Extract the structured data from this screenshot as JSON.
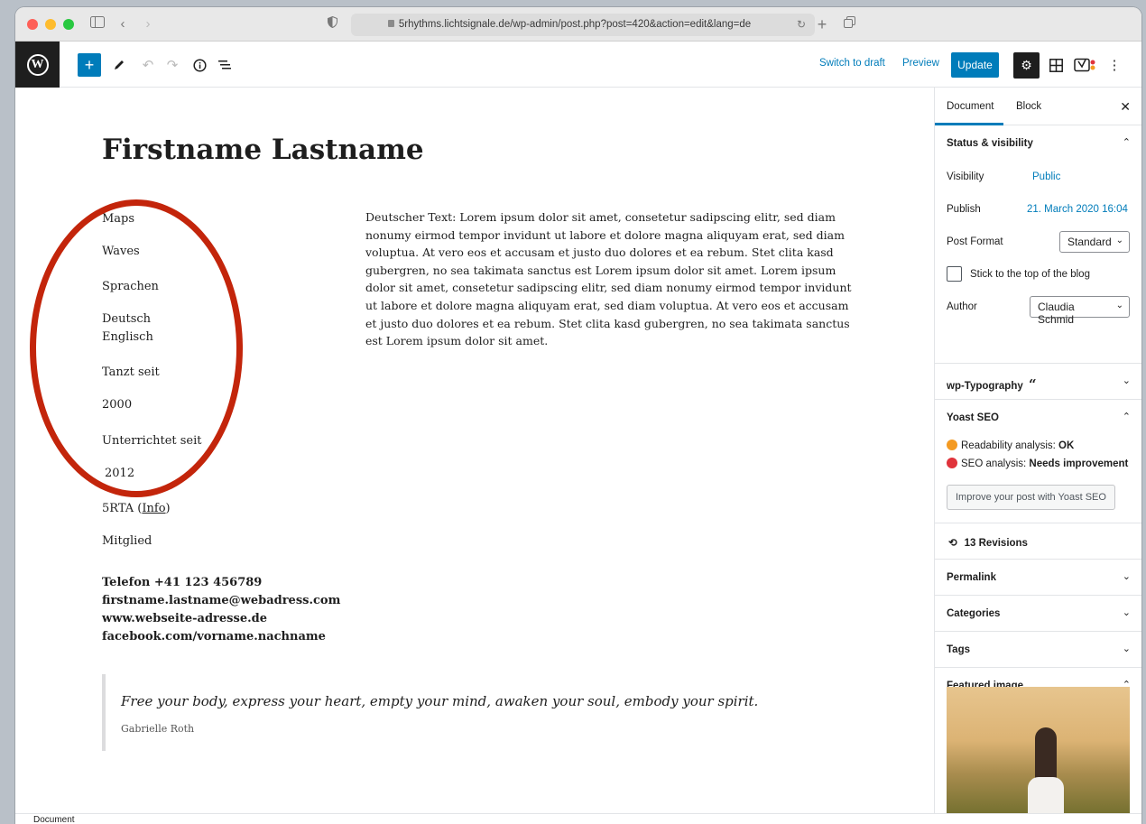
{
  "browser": {
    "url": "5rhythms.lichtsignale.de/wp-admin/post.php?post=420&action=edit&lang=de"
  },
  "toolbar": {
    "switch_to_draft": "Switch to draft",
    "preview": "Preview",
    "update": "Update"
  },
  "post": {
    "title": "Firstname Lastname",
    "left_column": [
      "Maps",
      "Waves",
      "Sprachen",
      "Deutsch",
      "Englisch",
      "Tanzt seit",
      "2000",
      "Unterrichtet seit",
      "2012",
      "5RTA (",
      "Info",
      ")",
      "Mitglied"
    ],
    "contacts": [
      "Telefon +41 123 456789",
      "firstname.lastname@webadress.com",
      "www.webseite-adresse.de",
      "facebook.com/vorname.nachname"
    ],
    "body_text": "Deutscher Text: Lorem ipsum dolor sit amet, consetetur sadipscing elitr, sed diam nonumy eirmod tempor invidunt ut labore et dolore magna aliquyam erat, sed diam voluptua. At vero eos et accusam et justo duo dolores et ea rebum. Stet clita kasd gubergren, no sea takimata sanctus est Lorem ipsum dolor sit amet. Lorem ipsum dolor sit amet, consetetur sadipscing elitr, sed diam nonumy eirmod tempor invidunt ut labore et dolore magna aliquyam erat, sed diam voluptua. At vero eos et accusam et justo duo dolores et ea rebum. Stet clita kasd gubergren, no sea takimata sanctus est Lorem ipsum dolor sit amet.",
    "quote": "Free your body, express your heart, empty your mind, awaken your soul, embody your spirit.",
    "quote_cite": "Gabrielle Roth"
  },
  "sidebar": {
    "tabs": [
      "Document",
      "Block"
    ],
    "status": {
      "title": "Status & visibility",
      "visibility_label": "Visibility",
      "visibility_value": "Public",
      "publish_label": "Publish",
      "publish_value": "21. March 2020 16:04",
      "post_format_label": "Post Format",
      "post_format_value": "Standard",
      "sticky_label": "Stick to the top of the blog",
      "author_label": "Author",
      "author_value": "Claudia Schmid"
    },
    "typography": "wp-Typography",
    "yoast": {
      "title": "Yoast SEO",
      "readability_prefix": "Readability analysis: ",
      "readability_value": "OK",
      "seo_prefix": "SEO analysis: ",
      "seo_value": "Needs improvement",
      "button": "Improve your post with Yoast SEO"
    },
    "revisions": "13 Revisions",
    "permalink": "Permalink",
    "categories": "Categories",
    "tags": "Tags",
    "featured_image": "Featured image"
  },
  "status_bar": "Document",
  "colors": {
    "wp_blue": "#007cba",
    "annotation_red": "#c3250b"
  }
}
